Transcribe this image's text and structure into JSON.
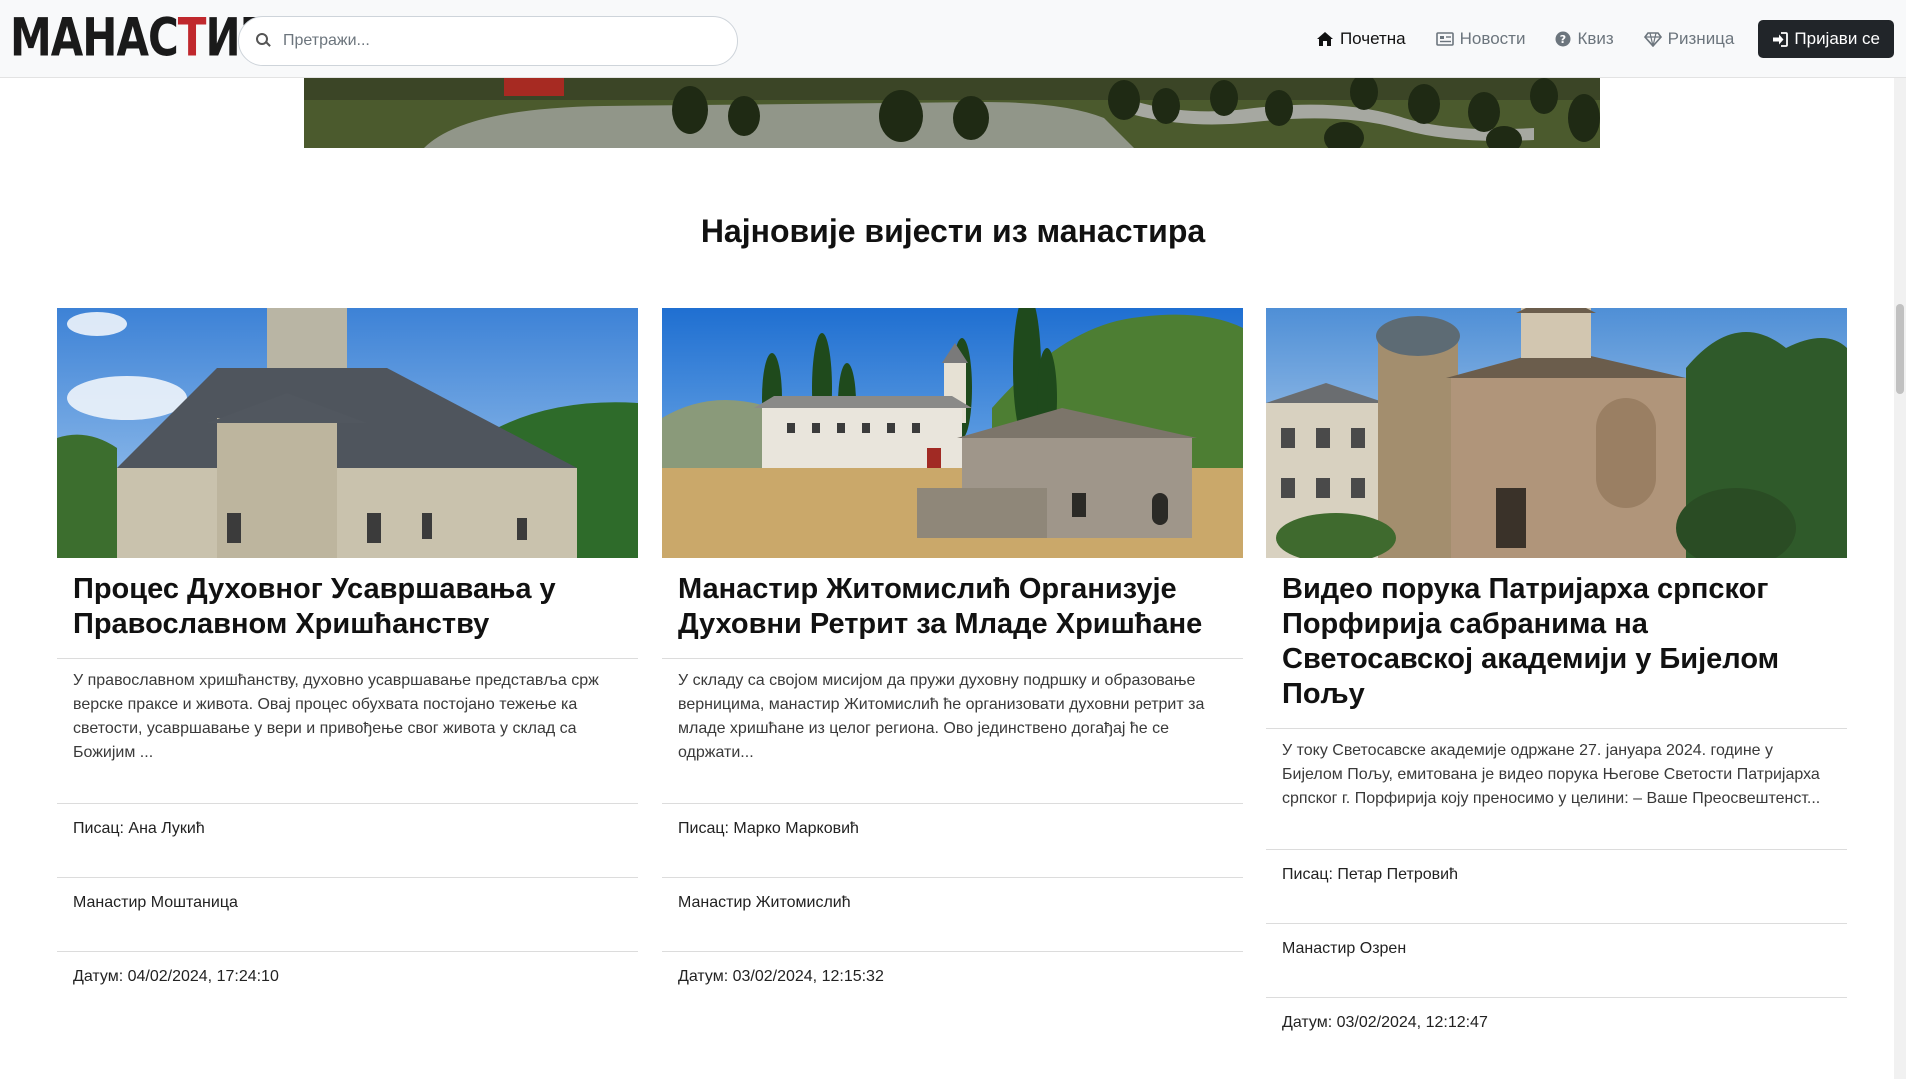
{
  "nav": {
    "logo_text_a": "МАНАС",
    "logo_text_cross": "Т",
    "logo_text_b": "ИРИ",
    "search_placeholder": "Претражи...",
    "links": [
      {
        "label": "Почетна",
        "icon": "home-icon"
      },
      {
        "label": "Новости",
        "icon": "newspaper-icon"
      },
      {
        "label": "Квиз",
        "icon": "question-circle-icon"
      },
      {
        "label": "Ризница",
        "icon": "gem-icon"
      }
    ],
    "login_label": "Пријави се",
    "login_icon": "sign-in-icon"
  },
  "main": {
    "section_title": "Најновије вијести из манастира",
    "cards": [
      {
        "title": "Процес Духовног Усавршавања у Православном Хришћанству",
        "excerpt": "У православном хришћанству, духовно усавршавање представља срж верске праксе и живота. Овај процес обухвата постојано тежење ка светости, усавршавање у вери и привођење свог живота у склад са Божијим ...",
        "author": "Писац: Ана Лукић",
        "monastery": "Манастир Моштаница",
        "date": "Датум: 04/02/2024, 17:24:10"
      },
      {
        "title": "Манастир Житомислић Организује Духовни Ретрит за Младе Хришћане",
        "excerpt": "У складу са својом мисијом да пружи духовну подршку и образовање верницима, манастир Житомислић ће организовати духовни ретрит за младе хришћане из целог региона. Ово јединствено догађај ће се одржати...",
        "author": "Писац: Марко Марковић",
        "monastery": "Манастир Житомислић",
        "date": "Датум: 03/02/2024, 12:15:32"
      },
      {
        "title": "Видео порука Патријарха српског Порфирија сабранима на Светосавској академији у Бијелом Пољу",
        "excerpt": "У току Светосавске академије одржане 27. јануара 2024. године у Бијелом Пољу, емитована је видео порука Његове Светости Патријарха српског г. Порфирија коју преносимо у целини: – Ваше Преосвештенст...",
        "author": "Писац: Петар Петровић",
        "monastery": "Манастир Озрен",
        "date": "Датум: 03/02/2024, 12:12:47"
      }
    ]
  },
  "colors": {
    "logo_cross": "#c0282d",
    "login_bg": "#212529",
    "navbar_bg": "#f8f9fa"
  }
}
